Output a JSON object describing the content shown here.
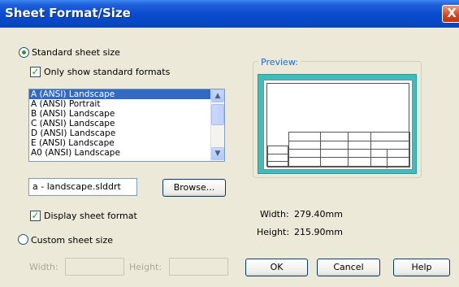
{
  "window": {
    "title": "Sheet Format/Size",
    "close_glyph": "X"
  },
  "standard": {
    "radio_label": "Standard sheet size",
    "only_standard_label": "Only show standard formats",
    "formats": [
      "A (ANSI) Landscape",
      "A (ANSI) Portrait",
      "B (ANSI) Landscape",
      "C (ANSI) Landscape",
      "D (ANSI) Landscape",
      "E (ANSI) Landscape",
      "A0 (ANSI) Landscape"
    ],
    "selected_index": 0,
    "format_file": "a - landscape.slddrt",
    "browse_label": "Browse...",
    "display_format_label": "Display sheet format"
  },
  "custom": {
    "radio_label": "Custom sheet size",
    "width_label": "Width:",
    "height_label": "Height:",
    "width_value": "",
    "height_value": ""
  },
  "preview": {
    "label": "Preview:",
    "width_label": "Width:",
    "width_value": "279.40mm",
    "height_label": "Height:",
    "height_value": "215.90mm"
  },
  "buttons": {
    "ok": "OK",
    "cancel": "Cancel",
    "help": "Help"
  },
  "colors": {
    "title_bar": "#0a4bd0",
    "preview_bg": "#3dbdbd",
    "selection": "#316ac5"
  }
}
